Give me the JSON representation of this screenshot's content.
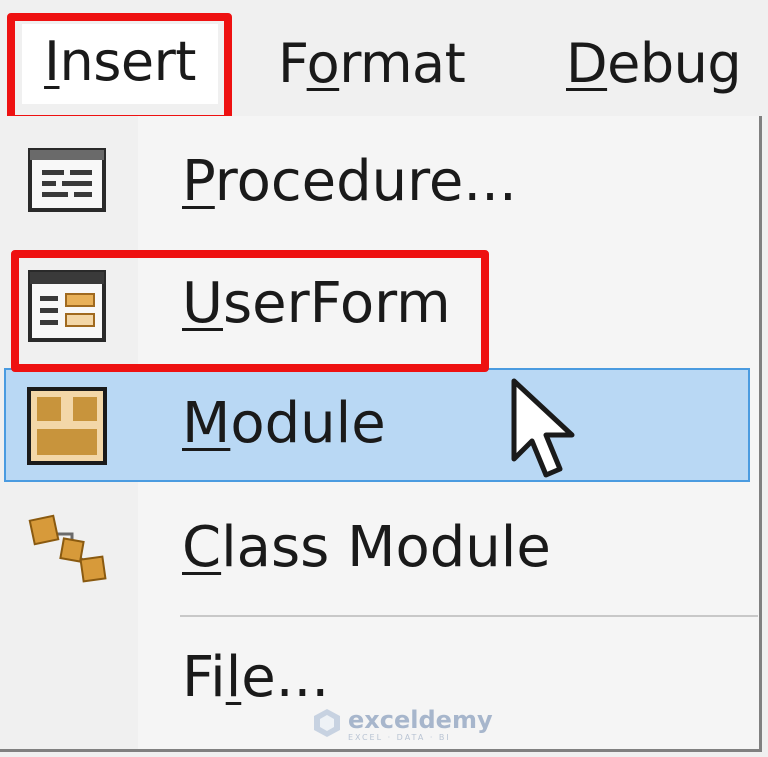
{
  "menubar": {
    "items": [
      {
        "label_plain": "nsert",
        "mnemonic": "I",
        "name": "Insert"
      },
      {
        "label_pre": "F",
        "mnemonic": "o",
        "label_post": "rmat",
        "name": "Format"
      },
      {
        "mnemonic": "D",
        "label_post": "ebug",
        "name": "Debug"
      }
    ]
  },
  "insert_menu": {
    "items": [
      {
        "mnemonic": "P",
        "rest": "rocedure...",
        "icon": "procedure-icon"
      },
      {
        "mnemonic": "U",
        "rest": "serForm",
        "icon": "userform-icon"
      },
      {
        "mnemonic": "M",
        "rest": "odule",
        "icon": "module-icon",
        "highlighted": true
      },
      {
        "mnemonic": "C",
        "rest": "lass Module",
        "icon": "class-module-icon"
      },
      {
        "pre": "Fi",
        "mnemonic": "l",
        "rest": "e...",
        "icon": null
      }
    ]
  },
  "watermark": {
    "name": "exceldemy",
    "tagline": "EXCEL · DATA · BI"
  },
  "colors": {
    "highlight_fill": "#b9d8f4",
    "highlight_border": "#4a9be0",
    "annotation_red": "#ee1111",
    "icon_gold": "#c8943c"
  }
}
